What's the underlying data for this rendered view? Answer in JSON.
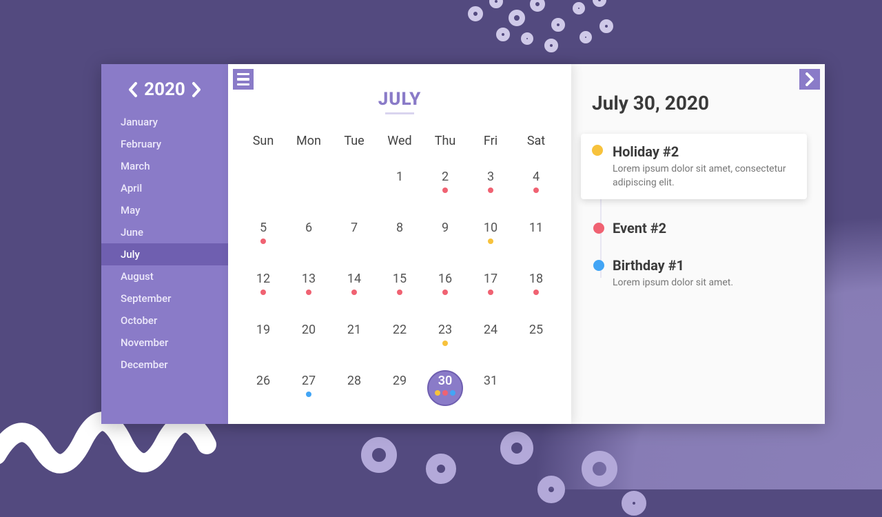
{
  "colors": {
    "purple_bg": "#534a7f",
    "sidebar": "#8a7bc8",
    "sidebar_active": "#6f5fb0",
    "dot_red": "#f06272",
    "dot_yellow": "#f7c23c",
    "dot_blue": "#42a5f5"
  },
  "year": "2020",
  "months": [
    "January",
    "February",
    "March",
    "April",
    "May",
    "June",
    "July",
    "August",
    "September",
    "October",
    "November",
    "December"
  ],
  "current_month_index": 6,
  "calendar": {
    "month_title": "JULY",
    "dow": [
      "Sun",
      "Mon",
      "Tue",
      "Wed",
      "Thu",
      "Fri",
      "Sat"
    ],
    "lead_blanks": 3,
    "days_in_month": 31,
    "selected_day": 30,
    "markers": {
      "2": [
        "dot_red"
      ],
      "3": [
        "dot_red"
      ],
      "4": [
        "dot_red"
      ],
      "5": [
        "dot_red"
      ],
      "10": [
        "dot_yellow"
      ],
      "12": [
        "dot_red"
      ],
      "13": [
        "dot_red"
      ],
      "14": [
        "dot_red"
      ],
      "15": [
        "dot_red"
      ],
      "16": [
        "dot_red"
      ],
      "17": [
        "dot_red"
      ],
      "18": [
        "dot_red"
      ],
      "23": [
        "dot_yellow"
      ],
      "27": [
        "dot_blue"
      ],
      "30": [
        "dot_yellow",
        "dot_red",
        "dot_blue"
      ]
    }
  },
  "events": {
    "heading": "July 30, 2020",
    "items": [
      {
        "title": "Holiday #2",
        "desc": "Lorem ipsum dolor sit amet, consectetur adipiscing elit.",
        "color": "dot_yellow",
        "card": true
      },
      {
        "title": "Event #2",
        "desc": "",
        "color": "dot_red",
        "card": false
      },
      {
        "title": "Birthday #1",
        "desc": "Lorem ipsum dolor sit amet.",
        "color": "dot_blue",
        "card": false
      }
    ]
  }
}
